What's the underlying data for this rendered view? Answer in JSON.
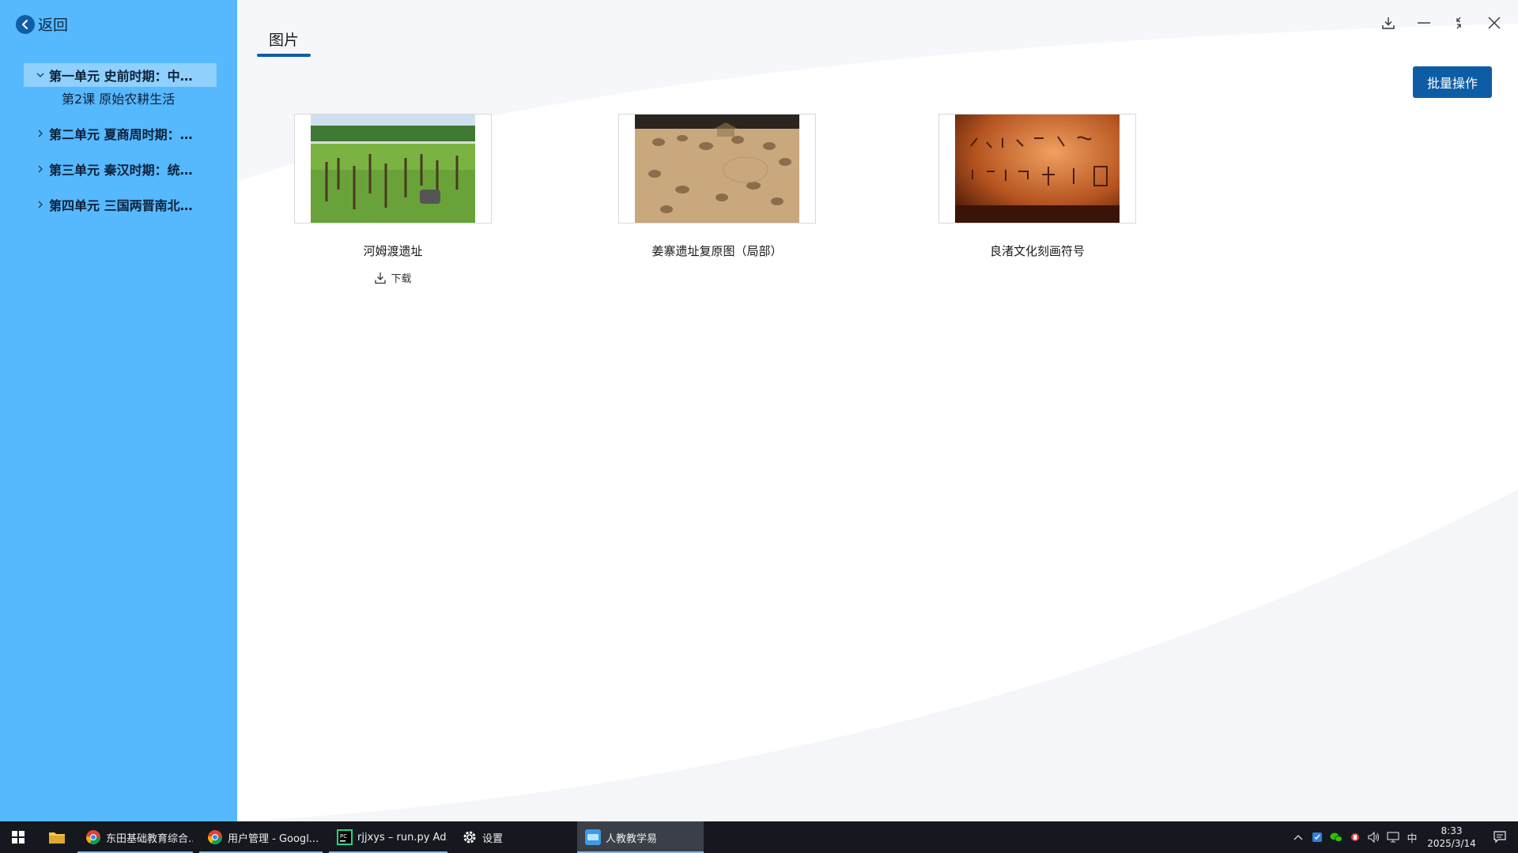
{
  "sidebar": {
    "back_label": "返回",
    "units": [
      {
        "label": "第一单元 史前时期：中…",
        "expanded": true
      },
      {
        "label": "第二单元 夏商周时期：…",
        "expanded": false
      },
      {
        "label": "第三单元 秦汉时期：统…",
        "expanded": false
      },
      {
        "label": "第四单元 三国两晋南北…",
        "expanded": false
      }
    ],
    "lesson": "第2课 原始农耕生活"
  },
  "main": {
    "tab_label": "图片",
    "batch_button": "批量操作",
    "accent_color": "#0d5da6",
    "items": [
      {
        "title": "河姆渡遗址",
        "download_label": "下载"
      },
      {
        "title": "姜寨遗址复原图（局部）"
      },
      {
        "title": "良渚文化刻画符号"
      }
    ]
  },
  "window_controls": [
    "download-icon",
    "minimize-icon",
    "restore-icon",
    "close-icon"
  ],
  "taskbar": {
    "apps": [
      {
        "label": "东田基础教育综合..."
      },
      {
        "label": "用户管理 - Googl..."
      },
      {
        "label": "rjjxys – run.py Ad..."
      },
      {
        "label": "设置"
      },
      {
        "label": "人教教学易"
      }
    ],
    "ime": "中",
    "time": "8:33",
    "date": "2025/3/14"
  }
}
